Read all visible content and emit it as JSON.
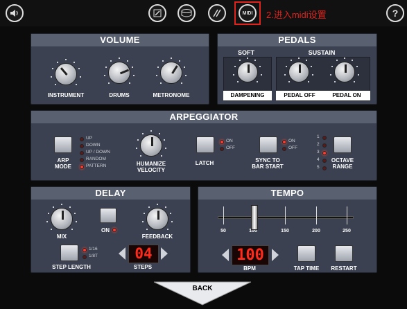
{
  "topbar": {
    "annotation": "2.进入midi设置",
    "icons": [
      "speaker-icon",
      "pencil-icon",
      "drum-icon",
      "sticks-icon",
      "midi-icon",
      "help-icon"
    ],
    "midi_label": "MIDI",
    "help_label": "?"
  },
  "volume": {
    "title": "VOLUME",
    "knobs": [
      {
        "label": "INSTRUMENT",
        "level": 0.35
      },
      {
        "label": "DRUMS",
        "level": 0.75
      },
      {
        "label": "METRONOME",
        "level": 0.62
      }
    ]
  },
  "pedals": {
    "title": "PEDALS",
    "soft": {
      "title": "SOFT",
      "label": "DAMPENING"
    },
    "sustain": {
      "title": "SUSTAIN",
      "labels": [
        "PEDAL OFF",
        "PEDAL ON"
      ]
    }
  },
  "arpeggiator": {
    "title": "ARPEGGIATOR",
    "arp_mode": {
      "label_line1": "ARP",
      "label_line2": "MODE",
      "options": [
        "UP",
        "DOWN",
        "UP / DOWN",
        "RANDOM",
        "PATTERN"
      ],
      "selected": "PATTERN"
    },
    "humanize": {
      "label_line1": "HUMANIZE",
      "label_line2": "VELOCITY"
    },
    "latch": {
      "label": "LATCH",
      "options": [
        "ON",
        "OFF"
      ],
      "selected": "ON"
    },
    "sync": {
      "label_line1": "SYNC TO",
      "label_line2": "BAR START",
      "options": [
        "ON",
        "OFF"
      ],
      "selected": "ON"
    },
    "octave": {
      "label_line1": "OCTAVE",
      "label_line2": "RANGE",
      "options": [
        "1",
        "2",
        "3",
        "4",
        "5"
      ],
      "selected": "3"
    }
  },
  "delay": {
    "title": "DELAY",
    "mix_label": "MIX",
    "on_label": "ON",
    "feedback_label": "FEEDBACK",
    "step_length_label": "STEP LENGTH",
    "step_options": [
      "1/16",
      "1/8T"
    ],
    "step_selected": "1/16",
    "steps_value": "04",
    "steps_label": "STEPS"
  },
  "tempo": {
    "title": "TEMPO",
    "ticks": [
      "50",
      "100",
      "150",
      "200",
      "250"
    ],
    "slider_value": 100,
    "bpm_value": "100",
    "bpm_label": "BPM",
    "tap_label": "TAP TIME",
    "restart_label": "RESTART"
  },
  "back_label": "BACK"
}
